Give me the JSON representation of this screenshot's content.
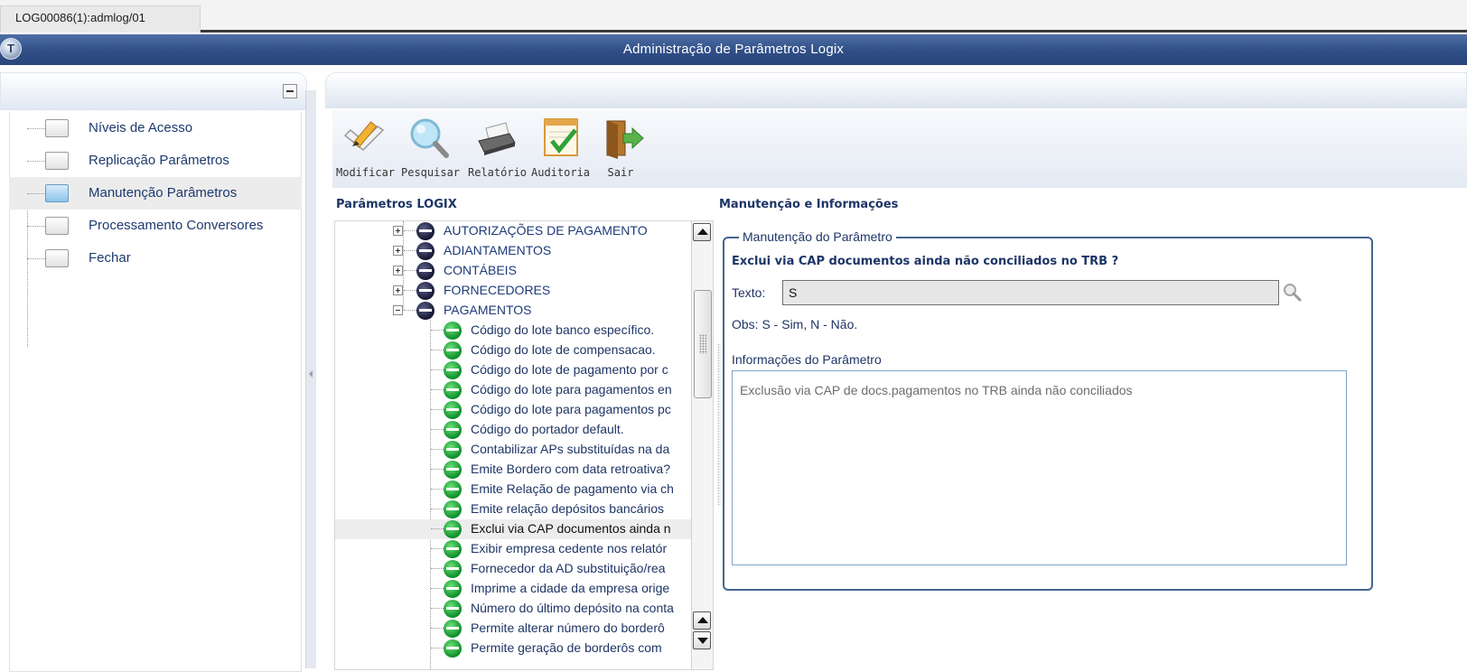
{
  "window": {
    "tab_label": "LOG00086(1):admlog/01",
    "title": "Administração de Parâmetros Logix"
  },
  "sidebar": {
    "items": [
      {
        "label": "Níveis de Acesso",
        "selected": false
      },
      {
        "label": "Replicação Parâmetros",
        "selected": false
      },
      {
        "label": "Manutenção Parâmetros",
        "selected": true
      },
      {
        "label": "Processamento Conversores",
        "selected": false
      },
      {
        "label": "Fechar",
        "selected": false
      }
    ]
  },
  "toolbar": {
    "buttons": [
      {
        "label": "Modificar",
        "icon": "pencil-check-icon"
      },
      {
        "label": "Pesquisar",
        "icon": "magnifier-icon"
      },
      {
        "label": "Relatório",
        "icon": "printer-icon"
      },
      {
        "label": "Auditoria",
        "icon": "checklist-icon"
      },
      {
        "label": "Sair",
        "icon": "exit-door-icon"
      }
    ]
  },
  "tree": {
    "title": "Parâmetros LOGIX",
    "categories": [
      {
        "label": "AUTORIZAÇÕES DE PAGAMENTO",
        "expanded": false
      },
      {
        "label": "ADIANTAMENTOS",
        "expanded": false
      },
      {
        "label": "CONTÁBEIS",
        "expanded": false
      },
      {
        "label": "FORNECEDORES",
        "expanded": false
      },
      {
        "label": "PAGAMENTOS",
        "expanded": true
      }
    ],
    "params": [
      {
        "label": "Código do lote banco específico."
      },
      {
        "label": "Código do lote de compensacao."
      },
      {
        "label": "Código do lote de pagamento por c"
      },
      {
        "label": "Código do lote para pagamentos en"
      },
      {
        "label": "Código do lote para pagamentos pc"
      },
      {
        "label": "Código do portador default."
      },
      {
        "label": "Contabilizar APs substituídas na da"
      },
      {
        "label": "Emite Bordero com data retroativa?"
      },
      {
        "label": "Emite Relação de pagamento via ch"
      },
      {
        "label": "Emite relação depósitos bancários"
      },
      {
        "label": "Exclui via CAP documentos ainda n",
        "selected": true
      },
      {
        "label": "Exibir empresa cedente nos relatór"
      },
      {
        "label": "Fornecedor da AD substituição/rea"
      },
      {
        "label": "Imprime a cidade da empresa orige"
      },
      {
        "label": "Número do último depósito na conta"
      },
      {
        "label": "Permite alterar número do borderô"
      },
      {
        "label": "Permite geração de borderôs com"
      }
    ]
  },
  "detail": {
    "section_title": "Manutenção e Informações",
    "group_label": "Manutenção do Parâmetro",
    "question": "Exclui via CAP documentos ainda não conciliados no TRB ?",
    "texto_label": "Texto:",
    "texto_value": "S",
    "obs": "Obs: S - Sim, N - Não.",
    "info_label": "Informações do Parâmetro",
    "info_text": "Exclusão via CAP de docs.pagamentos no TRB ainda não conciliados"
  },
  "colors": {
    "titlebar": "#2f4e86",
    "accent_text": "#1e3566",
    "fieldset_border": "#44648f",
    "node_green": "#0b8f29",
    "node_dark": "#141734"
  }
}
